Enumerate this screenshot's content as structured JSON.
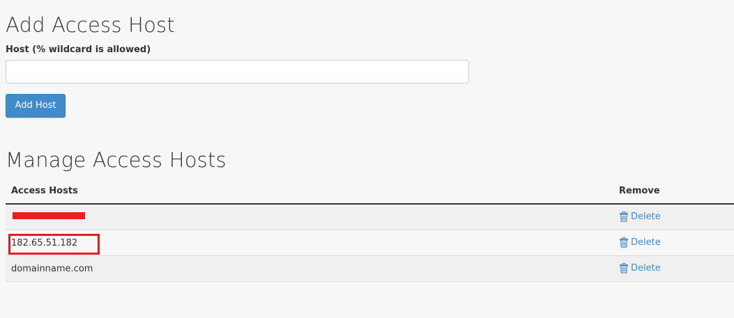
{
  "add_section": {
    "title": "Add Access Host",
    "host_label": "Host (% wildcard is allowed)",
    "host_input_value": "",
    "add_button_label": "Add Host"
  },
  "manage_section": {
    "title": "Manage Access Hosts",
    "columns": {
      "hosts": "Access Hosts",
      "remove": "Remove"
    },
    "rows": [
      {
        "host": "",
        "redacted": true,
        "delete_label": "Delete"
      },
      {
        "host": "182.65.51.182",
        "highlighted": true,
        "delete_label": "Delete"
      },
      {
        "host": "domainname.com",
        "delete_label": "Delete"
      }
    ]
  },
  "colors": {
    "primary_button": "#428bca",
    "link": "#428bca",
    "redaction": "#ec1c24",
    "highlight_border": "#e61b23"
  },
  "icons": {
    "delete": "trash-icon"
  }
}
